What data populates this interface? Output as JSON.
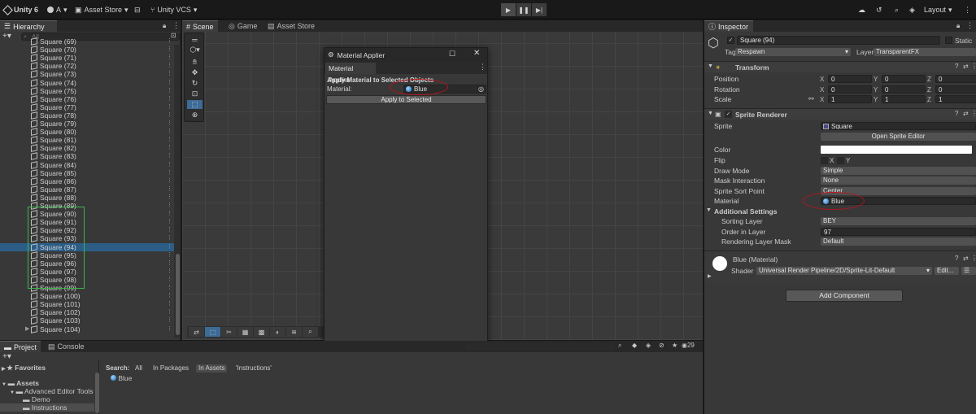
{
  "topbar": {
    "unity_version": "Unity 6",
    "account": "A",
    "asset_store": "Asset Store",
    "vcs": "Unity VCS",
    "layout": "Layout"
  },
  "hierarchy": {
    "tab_label": "Hierarchy",
    "search_placeholder": "All",
    "items": [
      "Square (69)",
      "Square (70)",
      "Square (71)",
      "Square (72)",
      "Square (73)",
      "Square (74)",
      "Square (75)",
      "Square (76)",
      "Square (77)",
      "Square (78)",
      "Square (79)",
      "Square (80)",
      "Square (81)",
      "Square (82)",
      "Square (83)",
      "Square (84)",
      "Square (85)",
      "Square (86)",
      "Square (87)",
      "Square (88)",
      "Square (89)",
      "Square (90)",
      "Square (91)",
      "Square (92)",
      "Square (93)",
      "Square (94)",
      "Square (95)",
      "Square (96)",
      "Square (97)",
      "Square (98)",
      "Square (99)",
      "Square (100)",
      "Square (101)",
      "Square (102)",
      "Square (103)",
      "Square (104)"
    ],
    "selected": "Square (94)"
  },
  "scene": {
    "tabs": [
      "Scene",
      "Game",
      "Asset Store"
    ]
  },
  "material_applier": {
    "window_title": "Material Applier",
    "tab_label": "Material Applier",
    "heading": "Apply Material to Selected Objects",
    "field_label": "Material:",
    "field_value": "Blue",
    "button_label": "Apply to Selected"
  },
  "inspector": {
    "tab_label": "Inspector",
    "object_name": "Square (94)",
    "static_label": "Static",
    "tag_label": "Tag",
    "tag_value": "Respawn",
    "layer_label": "Layer",
    "layer_value": "TransparentFX",
    "transform": {
      "title": "Transform",
      "position_label": "Position",
      "rotation_label": "Rotation",
      "scale_label": "Scale",
      "position": [
        "0",
        "0",
        "0"
      ],
      "rotation": [
        "0",
        "0",
        "0"
      ],
      "scale": [
        "1",
        "1",
        "1"
      ],
      "axes": [
        "X",
        "Y",
        "Z"
      ]
    },
    "sprite_renderer": {
      "title": "Sprite Renderer",
      "sprite_label": "Sprite",
      "sprite_value": "Square",
      "open_editor": "Open Sprite Editor",
      "color_label": "Color",
      "flip_label": "Flip",
      "flip_x": "X",
      "flip_y": "Y",
      "draw_mode_label": "Draw Mode",
      "draw_mode_value": "Simple",
      "mask_label": "Mask Interaction",
      "mask_value": "None",
      "sort_point_label": "Sprite Sort Point",
      "sort_point_value": "Center",
      "material_label": "Material",
      "material_value": "Blue",
      "additional": "Additional Settings",
      "sorting_layer_label": "Sorting Layer",
      "sorting_layer_value": "BEY",
      "order_label": "Order in Layer",
      "order_value": "97",
      "rendering_mask_label": "Rendering Layer Mask",
      "rendering_mask_value": "Default"
    },
    "material": {
      "name": "Blue (Material)",
      "shader_label": "Shader",
      "shader_value": "Universal Render Pipeline/2D/Sprite-Lit-Default",
      "edit_label": "Edit..."
    },
    "add_component": "Add Component"
  },
  "bottom": {
    "tabs": [
      "Project",
      "Console"
    ],
    "favorites": "Favorites",
    "assets": "Assets",
    "tree": [
      "Advanced Editor Tools P",
      "Demo",
      "Instructions"
    ],
    "search_label": "Search:",
    "scopes": [
      "All",
      "In Packages",
      "In Assets",
      "'Instructions'"
    ],
    "asset_item": "Blue",
    "count": "29"
  },
  "colors": {
    "selection": "#2c5d87",
    "annotation_red": "#b4151c",
    "annotation_green": "#3cb44b",
    "material_blue": "#3d8fd6"
  }
}
